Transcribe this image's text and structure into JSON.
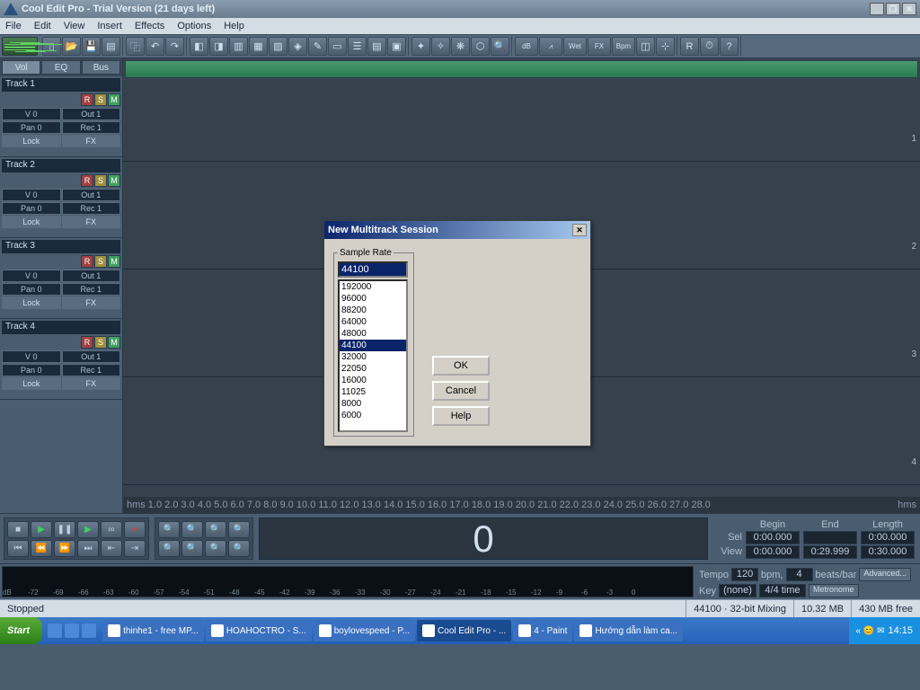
{
  "title": "Cool Edit Pro  - Trial Version (21 days left)",
  "menus": [
    "File",
    "Edit",
    "View",
    "Insert",
    "Effects",
    "Options",
    "Help"
  ],
  "tabs": [
    "Vol",
    "EQ",
    "Bus"
  ],
  "tracks": [
    {
      "name": "Track 1",
      "v": "V 0",
      "out": "Out 1",
      "pan": "Pan 0",
      "rec": "Rec 1",
      "lock": "Lock",
      "fx": "FX"
    },
    {
      "name": "Track 2",
      "v": "V 0",
      "out": "Out 1",
      "pan": "Pan 0",
      "rec": "Rec 1",
      "lock": "Lock",
      "fx": "FX"
    },
    {
      "name": "Track 3",
      "v": "V 0",
      "out": "Out 1",
      "pan": "Pan 0",
      "rec": "Rec 1",
      "lock": "Lock",
      "fx": "FX"
    },
    {
      "name": "Track 4",
      "v": "V 0",
      "out": "Out 1",
      "pan": "Pan 0",
      "rec": "Rec 1",
      "lock": "Lock",
      "fx": "FX"
    }
  ],
  "rulerUnit": "hms",
  "rulerTicks": [
    "1.0",
    "2.0",
    "3.0",
    "4.0",
    "5.0",
    "6.0",
    "7.0",
    "8.0",
    "9.0",
    "10.0",
    "11.0",
    "12.0",
    "13.0",
    "14.0",
    "15.0",
    "16.0",
    "17.0",
    "18.0",
    "19.0",
    "20.0",
    "21.0",
    "22.0",
    "23.0",
    "24.0",
    "25.0",
    "26.0",
    "27.0",
    "28.0"
  ],
  "bigtime": "0",
  "sel": {
    "hdr": [
      "Begin",
      "End",
      "Length"
    ],
    "sel": [
      "0:00.000",
      "",
      "0:00.000"
    ],
    "view": [
      "0:00.000",
      "0:29.999",
      "0:30.000"
    ],
    "selLbl": "Sel",
    "viewLbl": "View"
  },
  "tempo": {
    "label": "Tempo",
    "val": "120",
    "bpm": "bpm,",
    "beats": "4",
    "bb": "beats/bar",
    "adv": "Advanced...",
    "key": "Key",
    "keyval": "(none)",
    "ts": "4/4 time",
    "met": "Metronome"
  },
  "dbTicks": [
    "dB",
    "-72",
    "-69",
    "-66",
    "-63",
    "-60",
    "-57",
    "-54",
    "-51",
    "-48",
    "-45",
    "-42",
    "-39",
    "-36",
    "-33",
    "-30",
    "-27",
    "-24",
    "-21",
    "-18",
    "-15",
    "-12",
    "-9",
    "-6",
    "-3",
    "0"
  ],
  "status": {
    "l": "Stopped",
    "rate": "44100 · 32-bit Mixing",
    "mem": "10.32 MB",
    "free": "430 MB free"
  },
  "dialog": {
    "title": "New Multitrack Session",
    "legend": "Sample Rate",
    "input": "44100",
    "items": [
      "192000",
      "96000",
      "88200",
      "64000",
      "48000",
      "44100",
      "32000",
      "22050",
      "16000",
      "11025",
      "8000",
      "6000"
    ],
    "selected": "44100",
    "ok": "OK",
    "cancel": "Cancel",
    "help": "Help"
  },
  "taskbar": {
    "start": "Start",
    "items": [
      "thinhe1 - free MP...",
      "HOAHOCTRO - S...",
      "boylovespeed - P...",
      "Cool Edit Pro - ...",
      "4 - Paint",
      "Hướng dẫn làm ca..."
    ],
    "active": 3,
    "time": "14:15"
  }
}
